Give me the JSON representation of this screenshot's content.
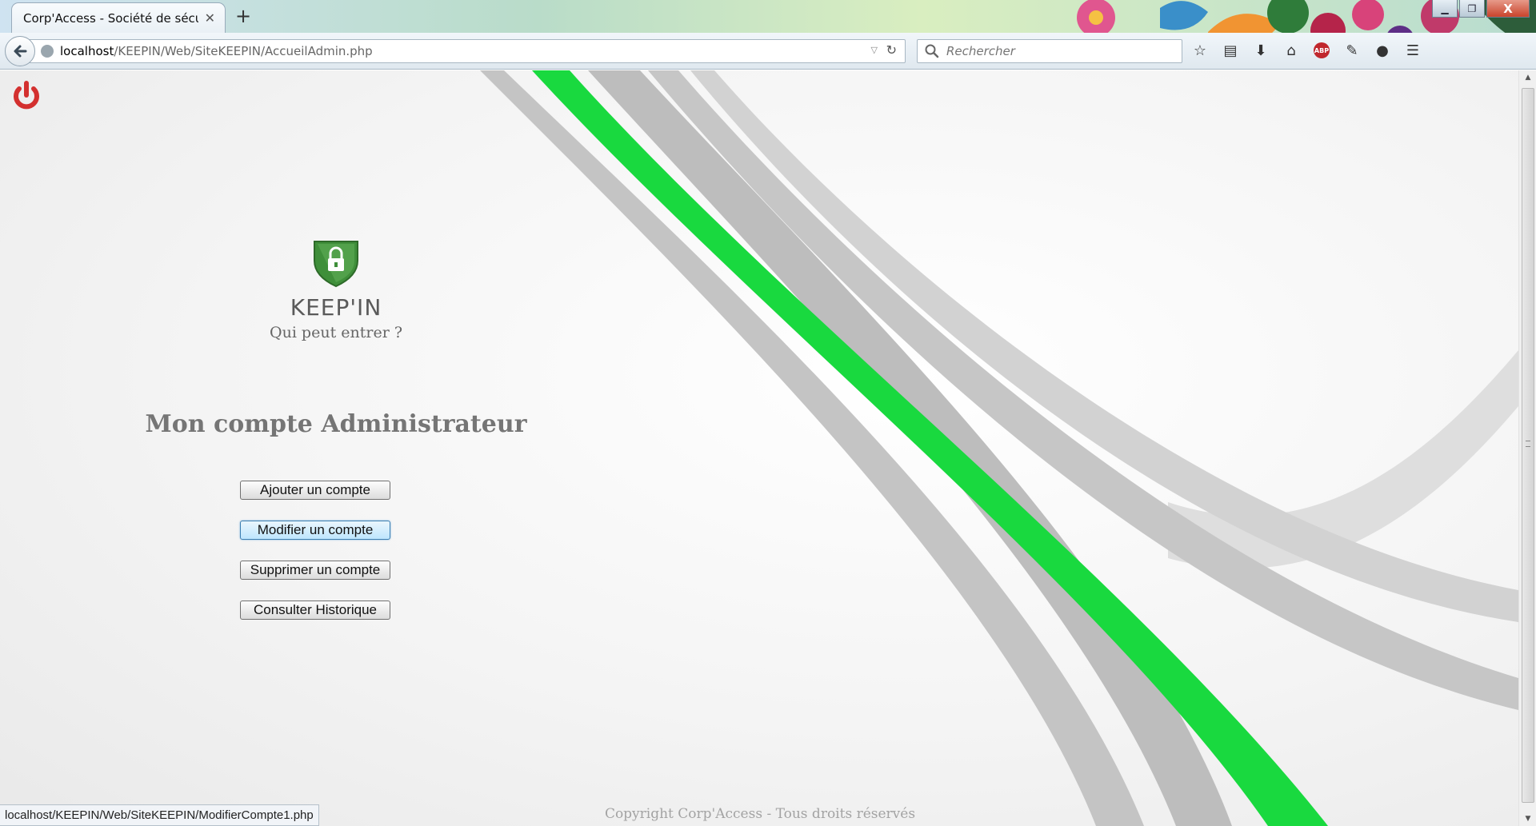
{
  "browser": {
    "tab_title": "Corp'Access - Société de sécuri...",
    "tab_close": "✕",
    "new_tab": "+",
    "url_host": "localhost",
    "url_path": "/KEEPIN/Web/SiteKEEPIN/AccueilAdmin.php",
    "search_placeholder": "Rechercher",
    "window_controls": {
      "minimize": "▁",
      "maximize": "❐",
      "close": "X"
    }
  },
  "brand": {
    "name": "KEEP'IN",
    "tagline": "Qui peut entrer ?"
  },
  "page": {
    "title": "Mon compte Administrateur",
    "actions": [
      {
        "label": "Ajouter un compte"
      },
      {
        "label": "Modifier un compte",
        "hovered": true
      },
      {
        "label": "Supprimer un compte"
      },
      {
        "label": "Consulter Historique"
      }
    ],
    "footer": "Copyright Corp'Access - Tous droits réservés"
  },
  "status_bar": {
    "link_url": "localhost/KEEPIN/Web/SiteKEEPIN/ModifierCompte1.php"
  },
  "icons": {
    "logout": "power-icon",
    "logo": "shield-lock-icon",
    "back": "back-arrow-icon",
    "search": "search-icon"
  },
  "colors": {
    "accent_green": "#19d93f",
    "logout_red": "#d3302f",
    "shield_green": "#3f8f3a"
  }
}
